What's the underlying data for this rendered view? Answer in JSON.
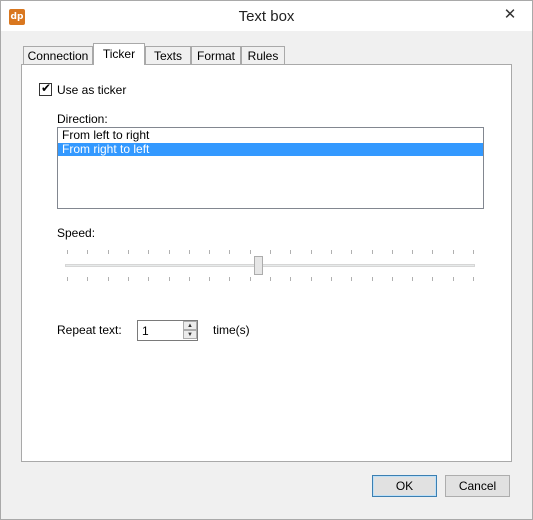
{
  "window": {
    "title": "Text box",
    "app_icon_text": "dp",
    "close_glyph": "✕"
  },
  "tabs": [
    {
      "label": "Connection",
      "active": false
    },
    {
      "label": "Ticker",
      "active": true
    },
    {
      "label": "Texts",
      "active": false
    },
    {
      "label": "Format",
      "active": false
    },
    {
      "label": "Rules",
      "active": false
    }
  ],
  "ticker": {
    "use_as_ticker_label": "Use as ticker",
    "use_as_ticker_checked": true,
    "direction_label": "Direction:",
    "direction_options": [
      "From left to right",
      "From right to left"
    ],
    "direction_selected": "From right to left",
    "speed_label": "Speed:",
    "speed_fraction": 0.47,
    "speed_tick_count": 21,
    "repeat_label": "Repeat text:",
    "repeat_value": "1",
    "repeat_unit": "time(s)"
  },
  "buttons": {
    "ok": "OK",
    "cancel": "Cancel"
  },
  "icons": {
    "check": "✔",
    "spin_up": "▲",
    "spin_down": "▼"
  }
}
